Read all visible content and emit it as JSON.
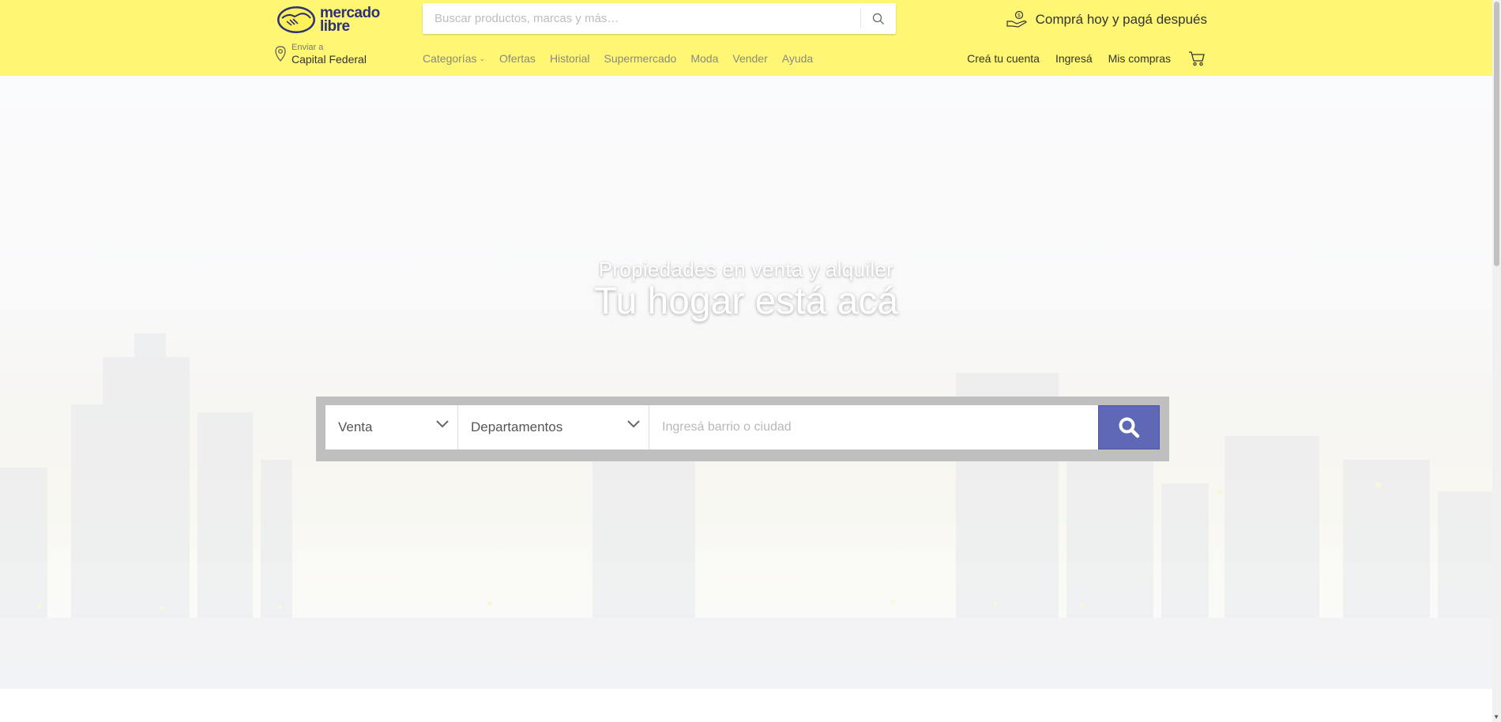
{
  "header": {
    "logo": {
      "line1": "mercado",
      "line2": "libre"
    },
    "search": {
      "placeholder": "Buscar productos, marcas y más…"
    },
    "promo": "Comprá hoy y pagá después",
    "location": {
      "label": "Enviar a",
      "value": "Capital Federal"
    },
    "nav": [
      "Categorías",
      "Ofertas",
      "Historial",
      "Supermercado",
      "Moda",
      "Vender",
      "Ayuda"
    ],
    "account": [
      "Creá tu cuenta",
      "Ingresá",
      "Mis compras"
    ]
  },
  "hero": {
    "subtitle": "Propiedades en venta y alquiler",
    "title": "Tu hogar está acá",
    "operation": "Venta",
    "property_type": "Departamentos",
    "location_placeholder": "Ingresá barrio o ciudad"
  },
  "colors": {
    "header_bg": "#fff774",
    "brand_blue": "#2d3277",
    "search_button": "#5e68b5"
  }
}
